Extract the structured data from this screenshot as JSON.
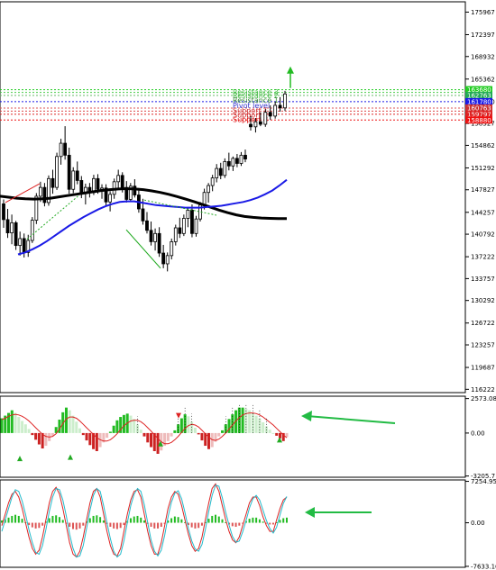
{
  "chart_data": [
    {
      "type": "candlestick",
      "panel": "price",
      "title": "",
      "y_ticks": [
        "175967",
        "172397",
        "168932",
        "165362",
        "161780",
        "158327",
        "154862",
        "151292",
        "147827",
        "144257",
        "140792",
        "137222",
        "133757",
        "130292",
        "126722",
        "123257",
        "119687",
        "116222"
      ],
      "y_tick_values": [
        175967,
        172397,
        168932,
        165362,
        161780,
        158327,
        154862,
        151292,
        147827,
        144257,
        140792,
        137222,
        133757,
        130292,
        126722,
        123257,
        119687,
        116222
      ],
      "ylim": [
        115700,
        177600
      ],
      "level_tags": [
        {
          "label": "163680",
          "value": 163680,
          "color": "#22cc22"
        },
        {
          "label": "162763",
          "value": 162763,
          "color": "#22aa55"
        },
        {
          "label": "161780",
          "value": 161780,
          "color": "#1a1ae6"
        },
        {
          "label": "160763",
          "value": 160763,
          "color": "#cc3333"
        },
        {
          "label": "159797",
          "value": 159797,
          "color": "#dd2222"
        },
        {
          "label": "158880",
          "value": 158880,
          "color": "#ee1111"
        }
      ],
      "level_lines": [
        {
          "value": 163680,
          "color": "#22cc22"
        },
        {
          "value": 163250,
          "color": "#44cc44"
        },
        {
          "value": 162763,
          "color": "#66bb66"
        },
        {
          "value": 161780,
          "color": "#1a1ae6"
        },
        {
          "value": 160763,
          "color": "#dd5555"
        },
        {
          "value": 160280,
          "color": "#dd4444"
        },
        {
          "value": 159797,
          "color": "#dd2222"
        },
        {
          "value": 158880,
          "color": "#ee1111"
        }
      ],
      "zone_labels": [
        {
          "text": "Resistance 3",
          "value": 163300,
          "color": "#44bb44"
        },
        {
          "text": "Resistance 2",
          "value": 162700,
          "color": "#44bb44"
        },
        {
          "text": "Resistance 1",
          "value": 162000,
          "color": "#338833"
        },
        {
          "text": "Pivot level",
          "value": 161150,
          "color": "#3333cc"
        },
        {
          "text": "Support 1",
          "value": 160350,
          "color": "#cc3333"
        },
        {
          "text": "Support 2",
          "value": 159650,
          "color": "#cc2222"
        },
        {
          "text": "Support 3",
          "value": 158950,
          "color": "#dd1111"
        }
      ],
      "ohlc": [
        [
          145600,
          146300,
          141800,
          143100
        ],
        [
          143100,
          144800,
          140200,
          141000
        ],
        [
          141000,
          143900,
          139200,
          142600
        ],
        [
          142600,
          142900,
          138300,
          139000
        ],
        [
          139000,
          141200,
          137400,
          140100
        ],
        [
          140100,
          140900,
          137100,
          137900
        ],
        [
          137900,
          140700,
          137200,
          139800
        ],
        [
          139800,
          143500,
          139400,
          143000
        ],
        [
          143000,
          147300,
          142400,
          146800
        ],
        [
          146800,
          149100,
          145900,
          148200
        ],
        [
          148200,
          148900,
          145200,
          145800
        ],
        [
          145800,
          150100,
          145300,
          149600
        ],
        [
          149600,
          151000,
          147200,
          148200
        ],
        [
          148200,
          153700,
          147800,
          153100
        ],
        [
          153100,
          155900,
          151800,
          155200
        ],
        [
          155200,
          157900,
          152600,
          153300
        ],
        [
          153300,
          154500,
          147200,
          147900
        ],
        [
          147900,
          151400,
          147300,
          150800
        ],
        [
          150800,
          152300,
          148700,
          149300
        ],
        [
          149300,
          150000,
          146500,
          147200
        ],
        [
          147200,
          148800,
          145500,
          148200
        ],
        [
          148200,
          148900,
          146600,
          147400
        ],
        [
          147400,
          150200,
          147000,
          149600
        ],
        [
          149600,
          150300,
          147200,
          147900
        ],
        [
          147900,
          148700,
          146400,
          148100
        ],
        [
          148100,
          148700,
          145300,
          145900
        ],
        [
          145900,
          147600,
          144400,
          147100
        ],
        [
          147100,
          149600,
          146400,
          149100
        ],
        [
          149100,
          151000,
          148100,
          150100
        ],
        [
          150100,
          150600,
          147400,
          148200
        ],
        [
          148200,
          149200,
          145800,
          146300
        ],
        [
          146300,
          148900,
          145900,
          148400
        ],
        [
          148400,
          149500,
          146600,
          147000
        ],
        [
          147000,
          148100,
          144200,
          144800
        ],
        [
          144800,
          146400,
          142300,
          142900
        ],
        [
          142900,
          144300,
          140900,
          141400
        ],
        [
          141400,
          142800,
          139000,
          139600
        ],
        [
          139600,
          141700,
          138200,
          140900
        ],
        [
          140900,
          141900,
          137200,
          137800
        ],
        [
          137800,
          139100,
          135400,
          136100
        ],
        [
          136100,
          137900,
          134900,
          137400
        ],
        [
          137400,
          140100,
          136800,
          139600
        ],
        [
          139600,
          142300,
          139000,
          141800
        ],
        [
          141800,
          143400,
          140200,
          140900
        ],
        [
          140900,
          143900,
          140500,
          143300
        ],
        [
          143300,
          145100,
          141900,
          144600
        ],
        [
          144600,
          145500,
          140300,
          140900
        ],
        [
          140900,
          143700,
          140400,
          143200
        ],
        [
          143200,
          145900,
          142800,
          145400
        ],
        [
          145400,
          148000,
          144700,
          147400
        ],
        [
          147400,
          148900,
          145800,
          148500
        ],
        [
          148500,
          150200,
          147600,
          149700
        ],
        [
          149700,
          151900,
          149000,
          151200
        ],
        [
          151200,
          152100,
          149500,
          150100
        ],
        [
          150100,
          152800,
          149700,
          152300
        ],
        [
          152300,
          153700,
          150900,
          151600
        ],
        [
          151600,
          153100,
          150800,
          152800
        ],
        [
          152800,
          153500,
          151400,
          152000
        ],
        [
          152000,
          153800,
          151600,
          153300
        ],
        [
          153300,
          154200,
          152200,
          152700
        ]
      ],
      "recent_ohlc": [
        [
          158200,
          159500,
          157200,
          157800
        ],
        [
          157800,
          159200,
          156900,
          158600
        ],
        [
          158600,
          160100,
          157900,
          158200
        ],
        [
          158200,
          160600,
          157800,
          160100
        ],
        [
          160100,
          161200,
          158900,
          159500
        ],
        [
          159500,
          161800,
          159100,
          161200
        ],
        [
          161200,
          162500,
          160200,
          160800
        ],
        [
          160800,
          163500,
          160300,
          163000
        ]
      ],
      "moving_averages": [
        {
          "color": "#000000",
          "values": [
            146800,
            146650,
            146500,
            146400,
            146350,
            146400,
            146500,
            146700,
            146900,
            147100,
            147300,
            147500,
            147700,
            147850,
            147950,
            148000,
            147950,
            147850,
            147650,
            147400,
            147100,
            146750,
            146350,
            145950,
            145500,
            145050,
            144600,
            144200,
            143850,
            143600,
            143450,
            143350,
            143300,
            143250,
            143250
          ]
        },
        {
          "color": "#1a1ae6",
          "values": [
            137600,
            137900,
            138400,
            139000,
            139700,
            140500,
            141300,
            142100,
            142800,
            143500,
            144100,
            144700,
            145200,
            145600,
            145900,
            146000,
            146000,
            145800,
            145600,
            145400,
            145300,
            145200,
            145100,
            145000,
            145000,
            145000,
            145100,
            145200,
            145300,
            145500,
            145700,
            145900,
            146200,
            146600,
            147100,
            147700,
            148500,
            149400
          ]
        }
      ]
    },
    {
      "type": "histogram",
      "panel": "macd",
      "y_ticks": [
        "2573.08",
        "0.00",
        "-3205.7"
      ],
      "y_tick_values": [
        2573.08,
        0,
        -3205.7
      ],
      "ylim": [
        -3300,
        2750
      ],
      "values": [
        1100,
        1300,
        1500,
        1700,
        1500,
        1200,
        900,
        650,
        300,
        -150,
        -500,
        -850,
        -1150,
        -950,
        -600,
        -200,
        450,
        1000,
        1550,
        1900,
        1700,
        1300,
        850,
        350,
        -150,
        -550,
        -900,
        -1200,
        -1350,
        -1050,
        -700,
        -350,
        100,
        550,
        950,
        1200,
        1350,
        1450,
        1300,
        1050,
        650,
        250,
        -250,
        -700,
        -1050,
        -1350,
        -1550,
        -1300,
        -950,
        -600,
        -250,
        200,
        650,
        1100,
        1400,
        1250,
        850,
        400,
        -100,
        -550,
        -950,
        -1200,
        -1050,
        -650,
        -250,
        200,
        650,
        1050,
        1400,
        1700,
        1900,
        1900,
        1800,
        1700,
        1500,
        1300,
        1100,
        800,
        500,
        250,
        0,
        -200,
        -400,
        -600,
        -300
      ],
      "signal": [
        1000,
        1100,
        1250,
        1350,
        1400,
        1350,
        1250,
        1100,
        900,
        650,
        400,
        150,
        -100,
        -250,
        -300,
        -250,
        -50,
        300,
        700,
        1050,
        1200,
        1200,
        1100,
        900,
        650,
        400,
        150,
        -100,
        -350,
        -500,
        -600,
        -600,
        -500,
        -300,
        -50,
        250,
        550,
        750,
        900,
        950,
        950,
        850,
        650,
        400,
        150,
        -150,
        -400,
        -650,
        -800,
        -800,
        -700,
        -500,
        -250,
        50,
        350,
        550,
        650,
        600,
        450,
        200,
        -50,
        -300,
        -500,
        -550,
        -450,
        -250,
        0,
        300,
        600,
        900,
        1150,
        1350,
        1450,
        1500,
        1500,
        1450,
        1350,
        1200,
        1000,
        800,
        600,
        350,
        100,
        -150,
        -350
      ]
    },
    {
      "type": "line",
      "panel": "oscillator",
      "y_ticks": [
        "7254.95",
        "0.00",
        "-7633.16"
      ],
      "y_tick_values": [
        7254.95,
        0,
        -7633.16
      ],
      "ylim": [
        -7800,
        7500
      ],
      "series": [
        {
          "color": "#dd2222",
          "values": [
            -500,
            1500,
            3500,
            5000,
            5500,
            4500,
            2500,
            0,
            -2500,
            -4500,
            -5500,
            -4800,
            -2500,
            500,
            3500,
            5500,
            6200,
            5000,
            2500,
            -500,
            -3500,
            -5500,
            -6000,
            -5000,
            -2500,
            500,
            3500,
            5500,
            6000,
            4500,
            1500,
            -1500,
            -4000,
            -5500,
            -5800,
            -4500,
            -1500,
            1500,
            4000,
            5500,
            5800,
            4500,
            1500,
            -1500,
            -4000,
            -5500,
            -5500,
            -3500,
            -500,
            2500,
            4500,
            5500,
            5000,
            3000,
            500,
            -2000,
            -4000,
            -5000,
            -4500,
            -2500,
            500,
            3500,
            6000,
            6800,
            5500,
            3000,
            500,
            -1500,
            -3000,
            -3500,
            -2500,
            -500,
            1500,
            3500,
            4500,
            4500,
            3000,
            1000,
            -500,
            -1500,
            -1500,
            500,
            2500,
            4000,
            4500
          ]
        },
        {
          "color": "#22bbcc",
          "values": [
            -1500,
            500,
            2500,
            4500,
            5800,
            5500,
            3800,
            1500,
            -1200,
            -3500,
            -5200,
            -5500,
            -4000,
            -1200,
            2000,
            4500,
            6000,
            5800,
            4000,
            1200,
            -2000,
            -4500,
            -6000,
            -5800,
            -4000,
            -1000,
            2200,
            4800,
            6000,
            5500,
            3000,
            0,
            -2800,
            -5000,
            -6000,
            -5500,
            -3200,
            0,
            3000,
            5000,
            6000,
            5500,
            3200,
            0,
            -3000,
            -5000,
            -5800,
            -4800,
            -2200,
            1000,
            3600,
            5200,
            5600,
            4200,
            1800,
            -1000,
            -3200,
            -4600,
            -5000,
            -3800,
            -1200,
            2000,
            4800,
            6600,
            6400,
            4400,
            1800,
            -400,
            -2400,
            -3400,
            -3200,
            -1600,
            400,
            2600,
            4200,
            4800,
            4000,
            2200,
            400,
            -1000,
            -1800,
            -800,
            1400,
            3400,
            4600
          ]
        }
      ],
      "bars": [
        400,
        600,
        900,
        1200,
        1400,
        1200,
        700,
        100,
        -400,
        -800,
        -1000,
        -900,
        -500,
        200,
        800,
        1200,
        1300,
        1000,
        500,
        -100,
        -700,
        -1100,
        -1200,
        -1000,
        -500,
        200,
        800,
        1200,
        1300,
        1000,
        400,
        -200,
        -700,
        -1000,
        -1100,
        -900,
        -400,
        300,
        800,
        1100,
        1200,
        900,
        400,
        -200,
        -700,
        -1000,
        -1000,
        -700,
        -200,
        400,
        800,
        1100,
        1000,
        600,
        100,
        -400,
        -800,
        -1000,
        -900,
        -500,
        100,
        700,
        1200,
        1400,
        1100,
        600,
        100,
        -300,
        -600,
        -700,
        -500,
        -100,
        300,
        700,
        900,
        900,
        600,
        200,
        -100,
        -300,
        -300,
        100,
        500,
        800,
        900
      ]
    }
  ]
}
